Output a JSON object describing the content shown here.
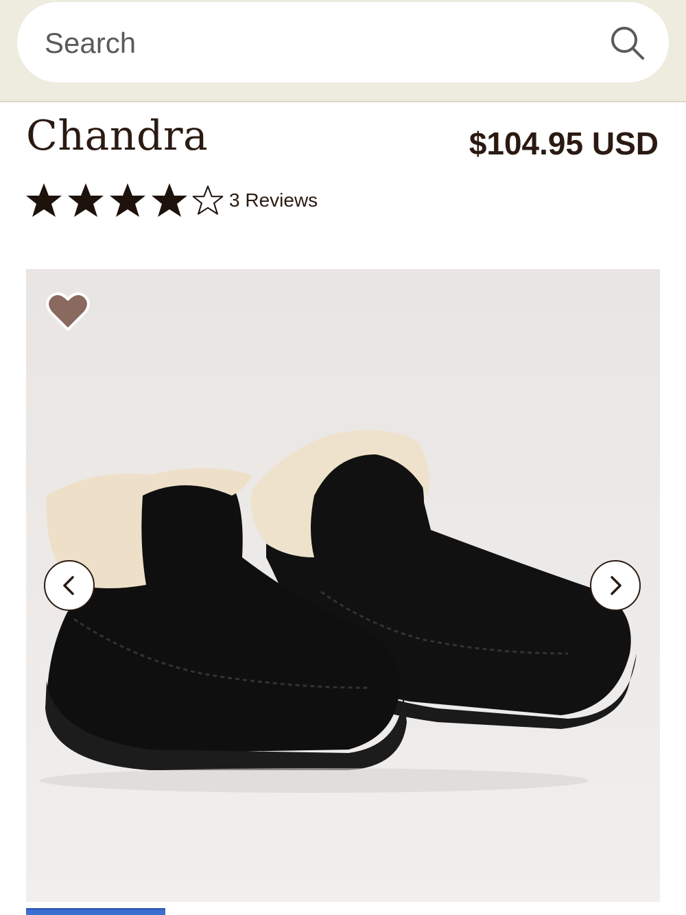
{
  "search": {
    "placeholder": "Search",
    "icon": "search-icon"
  },
  "product": {
    "title": "Chandra",
    "price": "$104.95 USD",
    "rating": {
      "value": 4,
      "max": 5
    },
    "reviews_label": "3 Reviews"
  },
  "gallery": {
    "favorite_icon": "heart-icon",
    "prev_icon": "chevron-left-icon",
    "next_icon": "chevron-right-icon"
  },
  "colors": {
    "top_bar": "#eeebdf",
    "text": "#2a1a12",
    "heart": "#8a6a5e",
    "indicator": "#3a6fd1"
  }
}
